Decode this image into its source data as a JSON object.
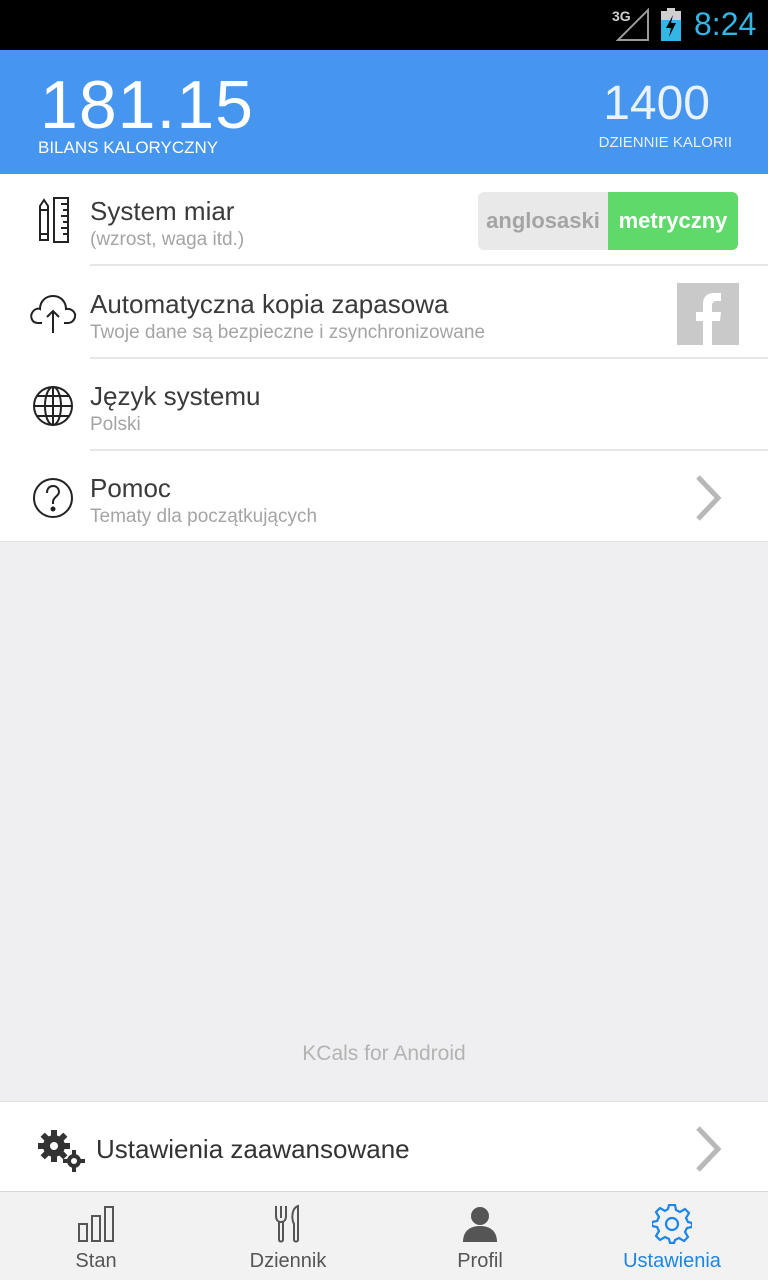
{
  "status_bar": {
    "network": "3G",
    "time": "8:24",
    "icons": [
      "signal-icon",
      "battery-charging-icon"
    ]
  },
  "header": {
    "balance_value": "181.15",
    "balance_label": "BILANS KALORYCZNY",
    "daily_value": "1400",
    "daily_label": "DZIENNIE KALORII"
  },
  "settings": [
    {
      "title": "System miar",
      "subtitle": "(wzrost, waga itd.)",
      "icon": "ruler-pencil-icon",
      "options": [
        "anglosaski",
        "metryczny"
      ],
      "selected": "metryczny"
    },
    {
      "title": "Automatyczna kopia zapasowa",
      "subtitle": "Twoje dane są bezpieczne i zsynchronizowane",
      "icon": "cloud-upload-icon",
      "action_icon": "facebook-icon"
    },
    {
      "title": "Język systemu",
      "subtitle": "Polski",
      "icon": "globe-icon"
    },
    {
      "title": "Pomoc",
      "subtitle": "Tematy dla początkujących",
      "icon": "help-circle-icon",
      "action_icon": "chevron-right-icon"
    }
  ],
  "footer_note": "KCals for Android",
  "advanced": {
    "label": "Ustawienia zaawansowane",
    "icon": "gears-icon"
  },
  "nav": [
    {
      "label": "Stan",
      "icon": "bar-chart-icon",
      "active": false
    },
    {
      "label": "Dziennik",
      "icon": "fork-knife-icon",
      "active": false
    },
    {
      "label": "Profil",
      "icon": "person-icon",
      "active": false
    },
    {
      "label": "Ustawienia",
      "icon": "gear-icon",
      "active": true
    }
  ],
  "colors": {
    "header": "#4695ef",
    "metric_selected": "#5fd96a",
    "nav_active": "#1b86e8",
    "status_time": "#33b5e5"
  }
}
